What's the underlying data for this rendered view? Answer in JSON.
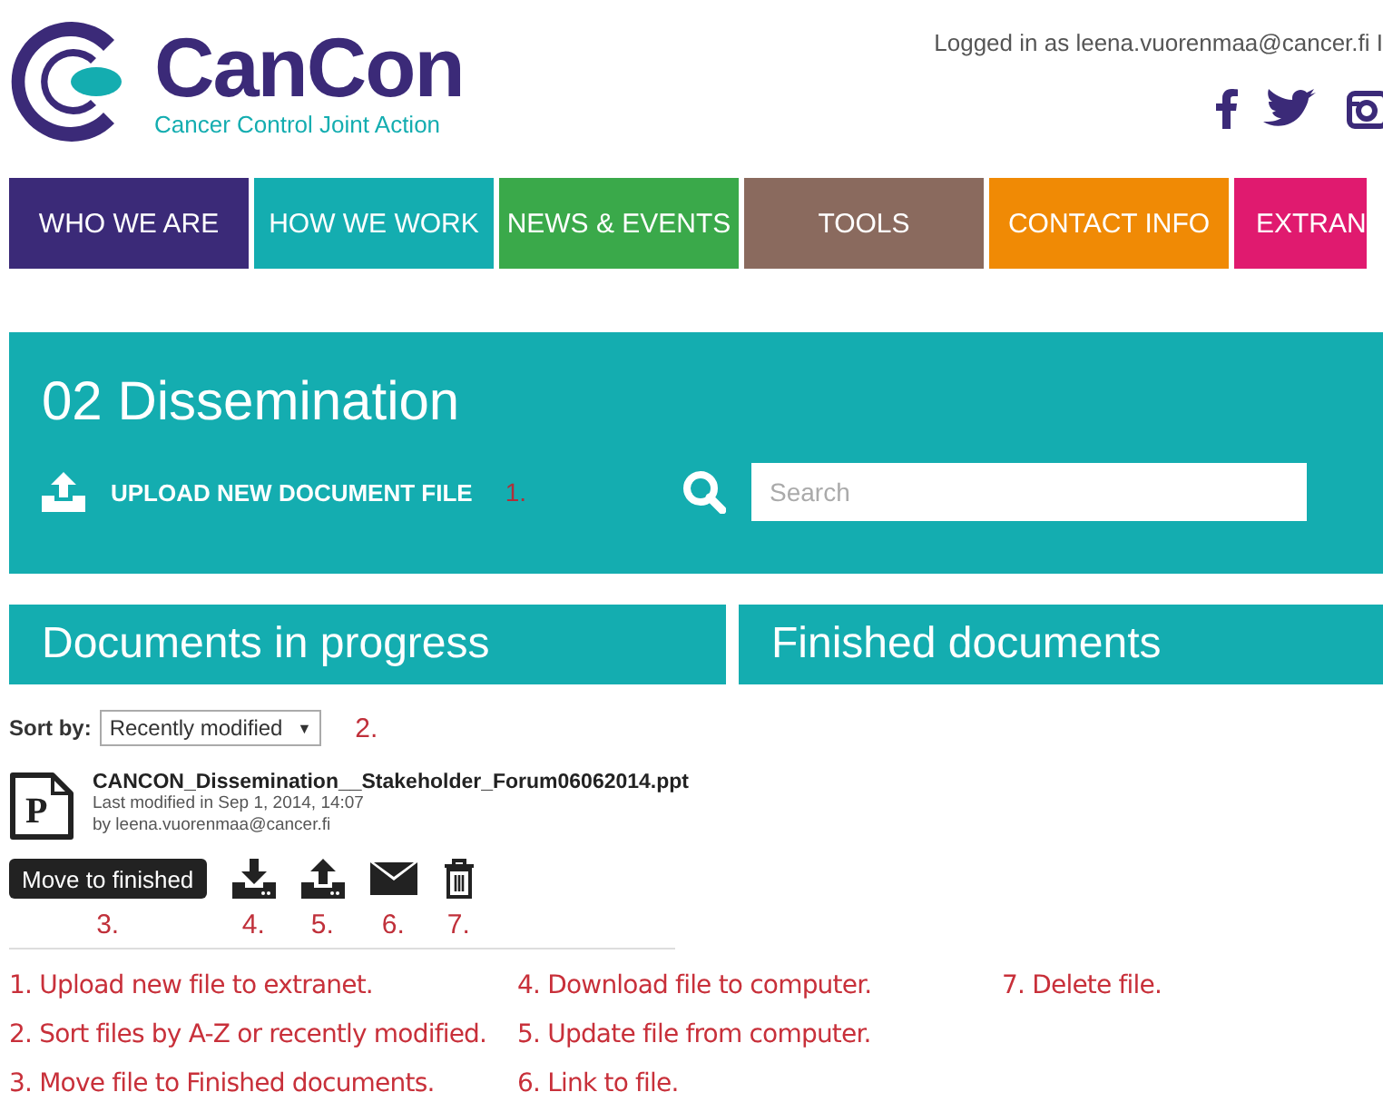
{
  "header": {
    "logo_title": "CanCon",
    "logo_subtitle": "Cancer Control Joint Action",
    "login_text": "Logged in as leena.vuorenmaa@cancer.fi I"
  },
  "nav": [
    {
      "label": "WHO WE ARE",
      "color": "#3b2a78"
    },
    {
      "label": "HOW WE WORK",
      "color": "#14adb0"
    },
    {
      "label": "NEWS & EVENTS",
      "color": "#3aa94a"
    },
    {
      "label": "TOOLS",
      "color": "#8a6a5e"
    },
    {
      "label": "CONTACT INFO",
      "color": "#f08a05"
    },
    {
      "label": "EXTRAN",
      "color": "#e01a6f"
    }
  ],
  "panel": {
    "title": "02 Dissemination",
    "upload_label": "UPLOAD NEW DOCUMENT FILE",
    "upload_note": "1.",
    "search": {
      "placeholder": "Search"
    }
  },
  "sections": [
    "Documents in progress",
    "Finished documents"
  ],
  "sort": {
    "label": "Sort by:",
    "value": "Recently modified",
    "caret": "▼",
    "note": "2."
  },
  "file": {
    "type_letter": "P",
    "name": "CANCON_Dissemination__Stakeholder_Forum06062014.ppt",
    "modified": "Last modified in Sep 1, 2014, 14:07",
    "by": "by leena.vuorenmaa@cancer.fi"
  },
  "actions": [
    {
      "kind": "button",
      "label": "Move to finished",
      "note": "3."
    },
    {
      "kind": "download",
      "note": "4."
    },
    {
      "kind": "upload",
      "note": "5."
    },
    {
      "kind": "mail",
      "note": "6."
    },
    {
      "kind": "delete",
      "note": "7."
    }
  ],
  "legend": [
    "1. Upload new file to extranet.",
    "2. Sort files by A-Z or recently modified.",
    "3. Move file to Finished documents.",
    "4. Download file to computer.",
    "5. Update file from computer.",
    "6. Link to file.",
    "7. Delete file."
  ]
}
